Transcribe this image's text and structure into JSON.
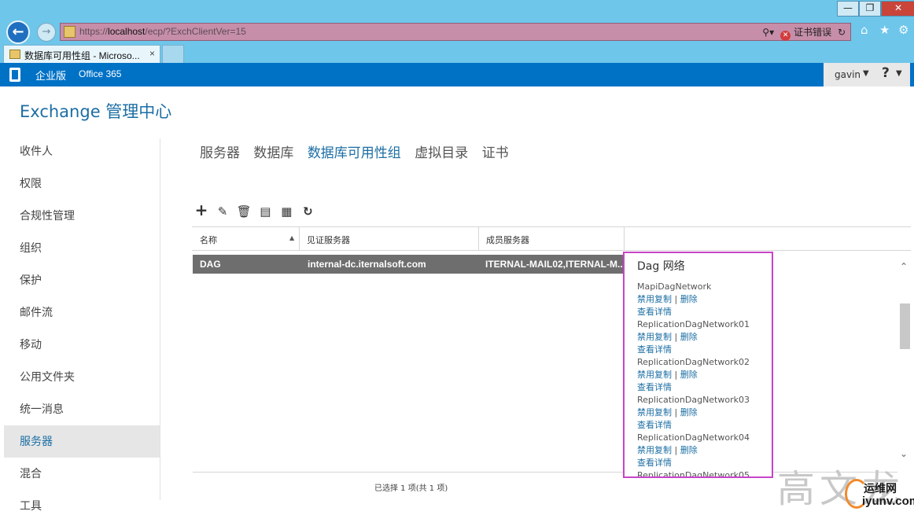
{
  "window": {
    "minimize": "—",
    "restore": "❐",
    "close": "✕"
  },
  "browser": {
    "url_prefix": "https://",
    "url_host": "localhost",
    "url_path": "/ecp/?ExchClientVer=15",
    "cert_error": "证书错误",
    "tab_title": "数据库可用性组 - Microso...",
    "tab_close": "×"
  },
  "o365bar": {
    "edition": "企业版",
    "office365": "Office 365",
    "user": "gavin",
    "help": "?"
  },
  "app_title": "Exchange 管理中心",
  "left_nav": [
    "收件人",
    "权限",
    "合规性管理",
    "组织",
    "保护",
    "邮件流",
    "移动",
    "公用文件夹",
    "统一消息",
    "服务器",
    "混合",
    "工具"
  ],
  "left_nav_active": "服务器",
  "sub_tabs": [
    {
      "label": "服务器",
      "active": false
    },
    {
      "label": "数据库",
      "active": false
    },
    {
      "label": "数据库可用性组",
      "active": true
    },
    {
      "label": "虚拟目录",
      "active": false
    },
    {
      "label": "证书",
      "active": false
    }
  ],
  "toolbar": [
    "add-icon",
    "edit-icon",
    "delete-icon",
    "manage-members-icon",
    "configure-network-icon",
    "refresh-icon"
  ],
  "table": {
    "columns": [
      "名称",
      "见证服务器",
      "成员服务器"
    ],
    "rows": [
      {
        "name": "DAG",
        "witness": "internal-dc.iternalsoft.com",
        "members": "ITERNAL-MAIL02,ITERNAL-M..."
      }
    ],
    "status": "已选择 1 项(共 1 项)"
  },
  "details": {
    "title": "Dag 网络",
    "networks": [
      {
        "name": "MapiDagNetwork",
        "disable": "禁用复制",
        "sep": "|",
        "remove": "删除",
        "view": "查看详情"
      },
      {
        "name": "ReplicationDagNetwork01",
        "disable": "禁用复制",
        "sep": "|",
        "remove": "删除",
        "view": "查看详情"
      },
      {
        "name": "ReplicationDagNetwork02",
        "disable": "禁用复制",
        "sep": "|",
        "remove": "删除",
        "view": "查看详情"
      },
      {
        "name": "ReplicationDagNetwork03",
        "disable": "禁用复制",
        "sep": "|",
        "remove": "删除",
        "view": "查看详情"
      },
      {
        "name": "ReplicationDagNetwork04",
        "disable": "禁用复制",
        "sep": "|",
        "remove": "删除",
        "view": "查看详情"
      },
      {
        "name": "ReplicationDagNetwork05"
      }
    ]
  },
  "watermark": {
    "text": "高文龙",
    "site_cn": "运维网",
    "site": "iyunv.com"
  },
  "colors": {
    "accent": "#1c6ea4",
    "o365_blue": "#0072c6",
    "highlight_border": "#c844c8",
    "selected_row": "#6e6e6e"
  }
}
